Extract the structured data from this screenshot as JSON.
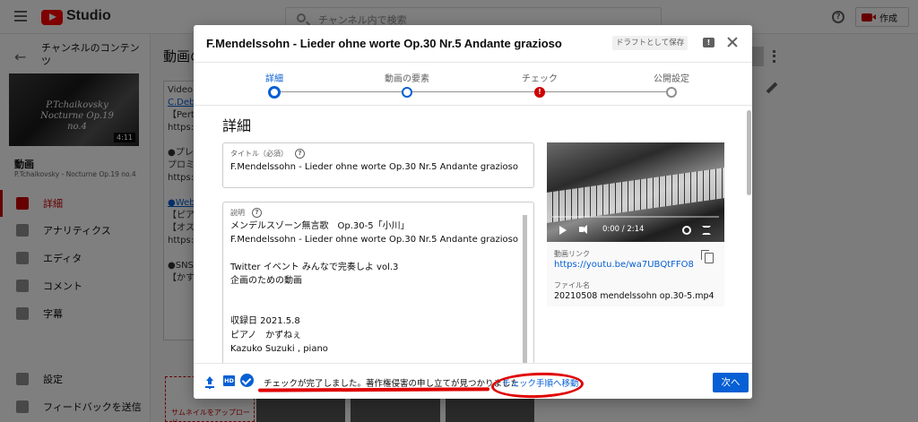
{
  "app": {
    "logo_text": "Studio",
    "search_placeholder": "チャンネル内で検索",
    "create_label": "作成"
  },
  "sidebar": {
    "channel_label": "チャンネルのコンテンツ",
    "thumb_text": "P.Tchaikovsky Nocturne Op.19 no.4",
    "thumb_duration": "4:11",
    "video_label": "動画",
    "video_subtitle": "P.Tchaikovsky - Nocturne Op.19 no.4",
    "items": [
      {
        "label": "詳細",
        "icon": "pencil-icon",
        "active": true
      },
      {
        "label": "アナリティクス",
        "icon": "analytics-icon",
        "active": false
      },
      {
        "label": "エディタ",
        "icon": "editor-icon",
        "active": false
      },
      {
        "label": "コメント",
        "icon": "comment-icon",
        "active": false
      },
      {
        "label": "字幕",
        "icon": "subtitles-icon",
        "active": false
      }
    ],
    "bottom_items": [
      {
        "label": "設定",
        "icon": "gear-icon"
      },
      {
        "label": "フィードバックを送信",
        "icon": "feedback-icon"
      }
    ]
  },
  "background": {
    "main_title": "動画の",
    "desc_lines": [
      "Video",
      "C.Deb",
      "【Pert",
      "https:",
      "",
      "●プレ",
      "プロミ",
      "https:",
      "",
      "●Web",
      "【ピア",
      "【オス",
      "https:",
      "",
      "●SNS",
      "【かす"
    ],
    "upload_thumb_label": "サムネイルをアップロード"
  },
  "dialog": {
    "title": "F.Mendelssohn - Lieder ohne worte Op.30 Nr.5 Andante grazioso",
    "draft_badge": "ドラフトとして保存",
    "steps": [
      {
        "label": "詳細",
        "state": "current"
      },
      {
        "label": "動画の要素",
        "state": "done"
      },
      {
        "label": "チェック",
        "state": "error"
      },
      {
        "label": "公開設定",
        "state": "pending"
      }
    ],
    "section_heading": "詳細",
    "title_field": {
      "label": "タイトル（必須）",
      "value": "F.Mendelssohn - Lieder ohne worte Op.30 Nr.5 Andante grazioso"
    },
    "desc_field": {
      "label": "説明",
      "lines": [
        "メンデルスゾーン無言歌　Op.30-5「小川」",
        "F.Mendelssohn - Lieder ohne worte Op.30 Nr.5 Andante grazioso",
        "",
        "Twitter イベント みんなで完奏しよ vol.3",
        "企画のための動画",
        "",
        "",
        "収録日 2021.5.8",
        "ピアノ　かずねぇ",
        "Kazuko Suzuki , piano"
      ]
    },
    "video": {
      "time": "0:00 / 2:14",
      "link_label": "動画リンク",
      "link_value": "https://youtu.be/wa7UBQtFFO8",
      "file_label": "ファイル名",
      "file_value": "20210508 mendelssohn op.30-5.mp4"
    },
    "footer": {
      "hd_badge": "HD",
      "status": "チェックが完了しました。著作権侵害の申し立てが見つかりました",
      "link": "チェック手順へ移動",
      "next_label": "次へ"
    }
  },
  "colors": {
    "accent": "#065fd4",
    "brand_red": "#ff0000",
    "error": "#cc0000",
    "annotation": "#e00000"
  }
}
